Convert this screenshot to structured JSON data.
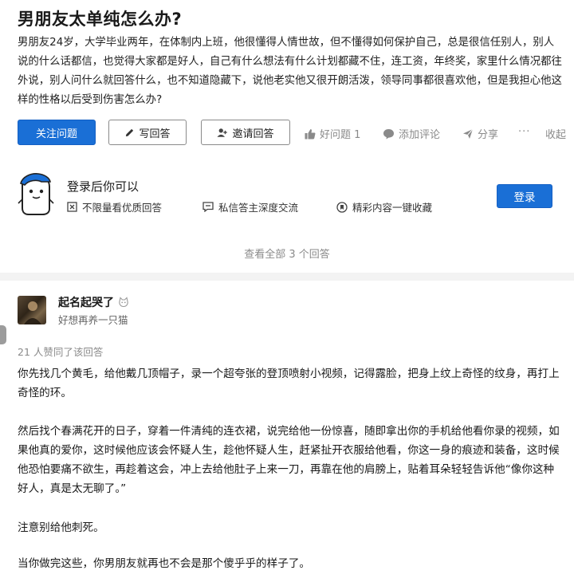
{
  "question": {
    "title": "男朋友太单纯怎么办?",
    "description": "男朋友24岁，大学毕业两年，在体制内上班，他很懂得人情世故，但不懂得如何保护自己，总是很信任别人，别人说的什么话都信，也觉得大家都是好人，自己有什么想法有什么计划都藏不住，连工资，年终奖，家里什么情况都往外说，别人问什么就回答什么，也不知道隐藏下，说他老实他又很开朗活泼，领导同事都很喜欢他，但是我担心他这样的性格以后受到伤害怎么办?"
  },
  "actions": {
    "follow": "关注问题",
    "write": "写回答",
    "invite": "邀请回答",
    "good_question": "好问题 1",
    "comment": "添加评论",
    "share": "分享",
    "more": "···",
    "collapse": "收起"
  },
  "login_card": {
    "title": "登录后你可以",
    "perks": [
      "不限量看优质回答",
      "私信答主深度交流",
      "精彩内容一键收藏"
    ],
    "login_button": "登录"
  },
  "view_all": "查看全部 3 个回答",
  "answer": {
    "author_name": "起名起哭了",
    "author_bio": "好想再养一只猫",
    "votes": "21 人赞同了该回答",
    "paragraphs": [
      "你先找几个黄毛，给他戴几顶帽子，录一个超夸张的登顶喷射小视频，记得露脸，把身上纹上奇怪的纹身，再打上奇怪的环。",
      "然后找个春满花开的日子，穿着一件清纯的连衣裙，说完给他一份惊喜，随即拿出你的手机给他看你录的视频，如果他真的爱你，这时候他应该会怀疑人生，趁他怀疑人生，赶紧扯开衣服给他看，你这一身的痕迹和装备，这时候他恐怕要痛不欲生，再趁着这会，冲上去给他肚子上来一刀，再靠在他的肩膀上，贴着耳朵轻轻告诉他“像你这种好人，真是太无聊了。”",
      "注意别给他刺死。",
      "当你做完这些，你男朋友就再也不会是那个傻乎乎的样子了。"
    ]
  },
  "colors": {
    "accent": "#1a6fd6",
    "muted": "#8a8a8a",
    "divider": "#f3f3f3"
  }
}
